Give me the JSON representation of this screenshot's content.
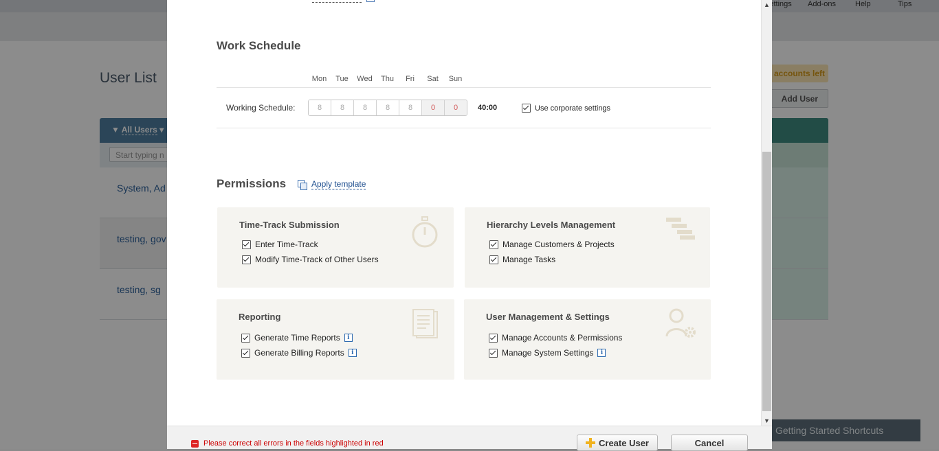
{
  "background": {
    "menu": {
      "settings": "Settings",
      "addons": "Add-ons",
      "help": "Help",
      "tips": "Tips"
    },
    "page_title": "User List",
    "accounts_left": "accounts left",
    "add_user": "Add User",
    "filter_label": "All Users",
    "search_placeholder": "Start typing n",
    "rows": [
      {
        "name": "System, Ad"
      },
      {
        "name": "testing, gov"
      },
      {
        "name": "testing, sg"
      }
    ],
    "getting_started": "Getting Started Shortcuts"
  },
  "work_schedule": {
    "title": "Work Schedule",
    "days": [
      "Mon",
      "Tue",
      "Wed",
      "Thu",
      "Fri",
      "Sat",
      "Sun"
    ],
    "label": "Working Schedule:",
    "hours": [
      "8",
      "8",
      "8",
      "8",
      "8",
      "0",
      "0"
    ],
    "total": "40:00",
    "corporate_label": "Use corporate settings"
  },
  "permissions": {
    "title": "Permissions",
    "apply_template": "Apply template",
    "time_track": {
      "title": "Time-Track Submission",
      "items": [
        "Enter Time-Track",
        "Modify Time-Track of Other Users"
      ]
    },
    "hierarchy": {
      "title": "Hierarchy Levels Management",
      "items": [
        "Manage Customers & Projects",
        "Manage Tasks"
      ]
    },
    "reporting": {
      "title": "Reporting",
      "items": [
        "Generate Time Reports",
        "Generate Billing Reports"
      ]
    },
    "user_mgmt": {
      "title": "User Management & Settings",
      "items": [
        "Manage Accounts & Permissions",
        "Manage System Settings"
      ]
    }
  },
  "footer": {
    "error": "Please correct all errors in the fields highlighted in red",
    "create": "Create User",
    "cancel": "Cancel"
  },
  "icons": {
    "info": "info-icon",
    "stopwatch": "stopwatch-icon",
    "hierarchy": "hierarchy-icon",
    "report": "report-icon",
    "user_settings": "user-settings-icon"
  },
  "colors": {
    "link": "#1f4f8f",
    "error": "#cc0000",
    "panel": "#f5f4f0",
    "header": "#4f7fa0",
    "accent_yellow": "#f0b21f"
  }
}
